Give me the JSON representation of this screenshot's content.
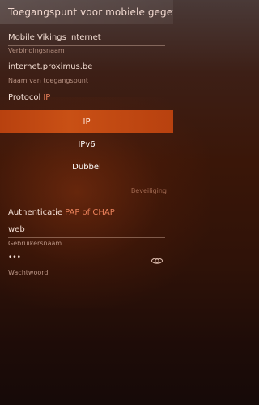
{
  "header": {
    "title": "Toegangspunt voor mobiele gegevens"
  },
  "connection_name": {
    "value": "Mobile Vikings Internet",
    "label": "Verbindingsnaam"
  },
  "access_point": {
    "value": "internet.proximus.be",
    "label": "Naam van toegangspunt"
  },
  "protocol": {
    "label": "Protocol",
    "value": "IP",
    "options": [
      {
        "label": "IP",
        "selected": true
      },
      {
        "label": "IPv6",
        "selected": false
      },
      {
        "label": "Dubbel",
        "selected": false
      }
    ]
  },
  "security": {
    "section_title": "Beveiliging"
  },
  "authentication": {
    "label": "Authenticatie",
    "value": "PAP of CHAP"
  },
  "username": {
    "value": "web",
    "label": "Gebruikersnaam"
  },
  "password": {
    "value": "•••",
    "label": "Wachtwoord",
    "toggle_icon": "eye-icon"
  },
  "colors": {
    "accent": "#e9805a",
    "selected_bg": "#c24a12"
  }
}
